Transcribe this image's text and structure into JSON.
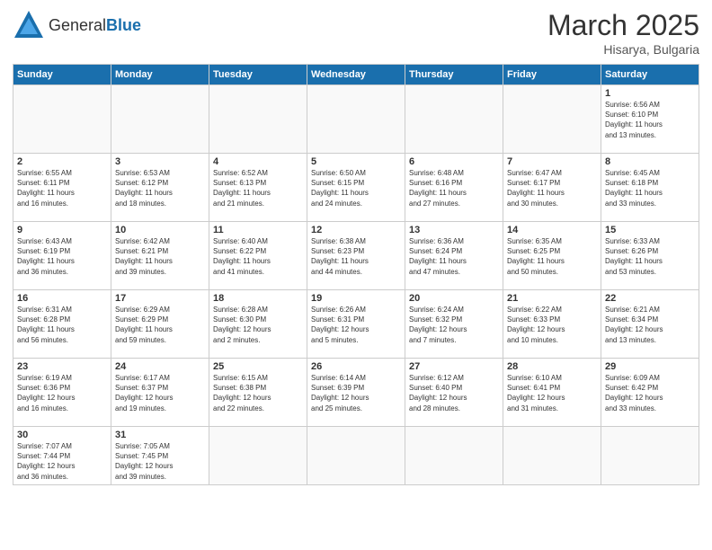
{
  "header": {
    "logo_text_normal": "General",
    "logo_text_blue": "Blue",
    "month_title": "March 2025",
    "location": "Hisarya, Bulgaria"
  },
  "weekdays": [
    "Sunday",
    "Monday",
    "Tuesday",
    "Wednesday",
    "Thursday",
    "Friday",
    "Saturday"
  ],
  "weeks": [
    [
      {
        "day": "",
        "info": ""
      },
      {
        "day": "",
        "info": ""
      },
      {
        "day": "",
        "info": ""
      },
      {
        "day": "",
        "info": ""
      },
      {
        "day": "",
        "info": ""
      },
      {
        "day": "",
        "info": ""
      },
      {
        "day": "1",
        "info": "Sunrise: 6:56 AM\nSunset: 6:10 PM\nDaylight: 11 hours\nand 13 minutes."
      }
    ],
    [
      {
        "day": "2",
        "info": "Sunrise: 6:55 AM\nSunset: 6:11 PM\nDaylight: 11 hours\nand 16 minutes."
      },
      {
        "day": "3",
        "info": "Sunrise: 6:53 AM\nSunset: 6:12 PM\nDaylight: 11 hours\nand 18 minutes."
      },
      {
        "day": "4",
        "info": "Sunrise: 6:52 AM\nSunset: 6:13 PM\nDaylight: 11 hours\nand 21 minutes."
      },
      {
        "day": "5",
        "info": "Sunrise: 6:50 AM\nSunset: 6:15 PM\nDaylight: 11 hours\nand 24 minutes."
      },
      {
        "day": "6",
        "info": "Sunrise: 6:48 AM\nSunset: 6:16 PM\nDaylight: 11 hours\nand 27 minutes."
      },
      {
        "day": "7",
        "info": "Sunrise: 6:47 AM\nSunset: 6:17 PM\nDaylight: 11 hours\nand 30 minutes."
      },
      {
        "day": "8",
        "info": "Sunrise: 6:45 AM\nSunset: 6:18 PM\nDaylight: 11 hours\nand 33 minutes."
      }
    ],
    [
      {
        "day": "9",
        "info": "Sunrise: 6:43 AM\nSunset: 6:19 PM\nDaylight: 11 hours\nand 36 minutes."
      },
      {
        "day": "10",
        "info": "Sunrise: 6:42 AM\nSunset: 6:21 PM\nDaylight: 11 hours\nand 39 minutes."
      },
      {
        "day": "11",
        "info": "Sunrise: 6:40 AM\nSunset: 6:22 PM\nDaylight: 11 hours\nand 41 minutes."
      },
      {
        "day": "12",
        "info": "Sunrise: 6:38 AM\nSunset: 6:23 PM\nDaylight: 11 hours\nand 44 minutes."
      },
      {
        "day": "13",
        "info": "Sunrise: 6:36 AM\nSunset: 6:24 PM\nDaylight: 11 hours\nand 47 minutes."
      },
      {
        "day": "14",
        "info": "Sunrise: 6:35 AM\nSunset: 6:25 PM\nDaylight: 11 hours\nand 50 minutes."
      },
      {
        "day": "15",
        "info": "Sunrise: 6:33 AM\nSunset: 6:26 PM\nDaylight: 11 hours\nand 53 minutes."
      }
    ],
    [
      {
        "day": "16",
        "info": "Sunrise: 6:31 AM\nSunset: 6:28 PM\nDaylight: 11 hours\nand 56 minutes."
      },
      {
        "day": "17",
        "info": "Sunrise: 6:29 AM\nSunset: 6:29 PM\nDaylight: 11 hours\nand 59 minutes."
      },
      {
        "day": "18",
        "info": "Sunrise: 6:28 AM\nSunset: 6:30 PM\nDaylight: 12 hours\nand 2 minutes."
      },
      {
        "day": "19",
        "info": "Sunrise: 6:26 AM\nSunset: 6:31 PM\nDaylight: 12 hours\nand 5 minutes."
      },
      {
        "day": "20",
        "info": "Sunrise: 6:24 AM\nSunset: 6:32 PM\nDaylight: 12 hours\nand 7 minutes."
      },
      {
        "day": "21",
        "info": "Sunrise: 6:22 AM\nSunset: 6:33 PM\nDaylight: 12 hours\nand 10 minutes."
      },
      {
        "day": "22",
        "info": "Sunrise: 6:21 AM\nSunset: 6:34 PM\nDaylight: 12 hours\nand 13 minutes."
      }
    ],
    [
      {
        "day": "23",
        "info": "Sunrise: 6:19 AM\nSunset: 6:36 PM\nDaylight: 12 hours\nand 16 minutes."
      },
      {
        "day": "24",
        "info": "Sunrise: 6:17 AM\nSunset: 6:37 PM\nDaylight: 12 hours\nand 19 minutes."
      },
      {
        "day": "25",
        "info": "Sunrise: 6:15 AM\nSunset: 6:38 PM\nDaylight: 12 hours\nand 22 minutes."
      },
      {
        "day": "26",
        "info": "Sunrise: 6:14 AM\nSunset: 6:39 PM\nDaylight: 12 hours\nand 25 minutes."
      },
      {
        "day": "27",
        "info": "Sunrise: 6:12 AM\nSunset: 6:40 PM\nDaylight: 12 hours\nand 28 minutes."
      },
      {
        "day": "28",
        "info": "Sunrise: 6:10 AM\nSunset: 6:41 PM\nDaylight: 12 hours\nand 31 minutes."
      },
      {
        "day": "29",
        "info": "Sunrise: 6:09 AM\nSunset: 6:42 PM\nDaylight: 12 hours\nand 33 minutes."
      }
    ],
    [
      {
        "day": "30",
        "info": "Sunrise: 7:07 AM\nSunset: 7:44 PM\nDaylight: 12 hours\nand 36 minutes."
      },
      {
        "day": "31",
        "info": "Sunrise: 7:05 AM\nSunset: 7:45 PM\nDaylight: 12 hours\nand 39 minutes."
      },
      {
        "day": "",
        "info": ""
      },
      {
        "day": "",
        "info": ""
      },
      {
        "day": "",
        "info": ""
      },
      {
        "day": "",
        "info": ""
      },
      {
        "day": "",
        "info": ""
      }
    ]
  ]
}
